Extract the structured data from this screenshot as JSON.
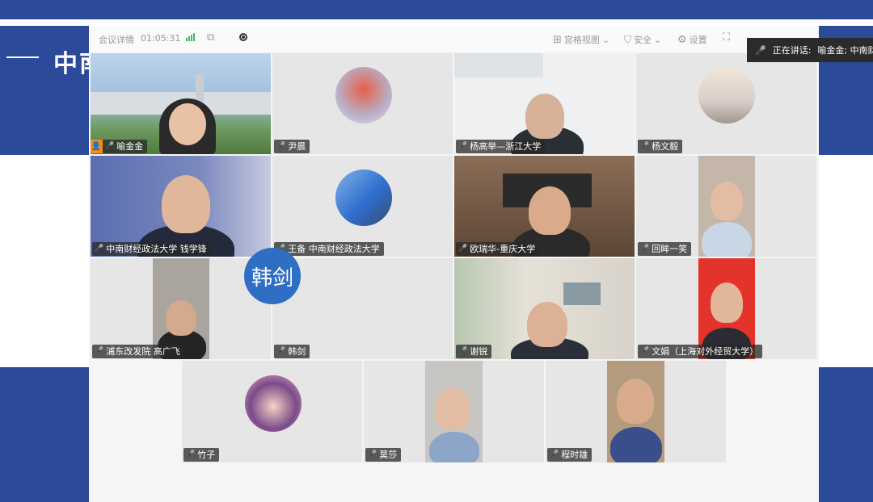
{
  "banner": {
    "title": "中南"
  },
  "toolbar": {
    "meeting_details": "会议详情",
    "duration": "01:05:31",
    "grid_view": "宫格视图",
    "security": "安全",
    "settings": "设置"
  },
  "speaking": {
    "label": "正在讲话:",
    "names": "喻金金; 中南财"
  },
  "participants": [
    {
      "name": "喻金金",
      "host": true
    },
    {
      "name": "尹晨"
    },
    {
      "name": "杨高举—浙江大学"
    },
    {
      "name": "杨文毅"
    },
    {
      "name": "中南财经政法大学 钱学锋"
    },
    {
      "name": "王备 中南财经政法大学"
    },
    {
      "name": "欧瑞华-重庆大学"
    },
    {
      "name": "回眸一笑"
    },
    {
      "name": "浦东改发院 高广飞"
    },
    {
      "name": "韩剑"
    },
    {
      "name": "谢锐"
    },
    {
      "name": "文娟（上海对外经贸大学）"
    },
    {
      "name": "竹子"
    },
    {
      "name": "莫莎"
    },
    {
      "name": "程时雄"
    }
  ],
  "avatar_text": {
    "hanjian": "韩剑"
  },
  "colors": {
    "accent_blue": "#2c4a9a",
    "active_border": "#2ec67a",
    "host_badge": "#f08a1c"
  }
}
